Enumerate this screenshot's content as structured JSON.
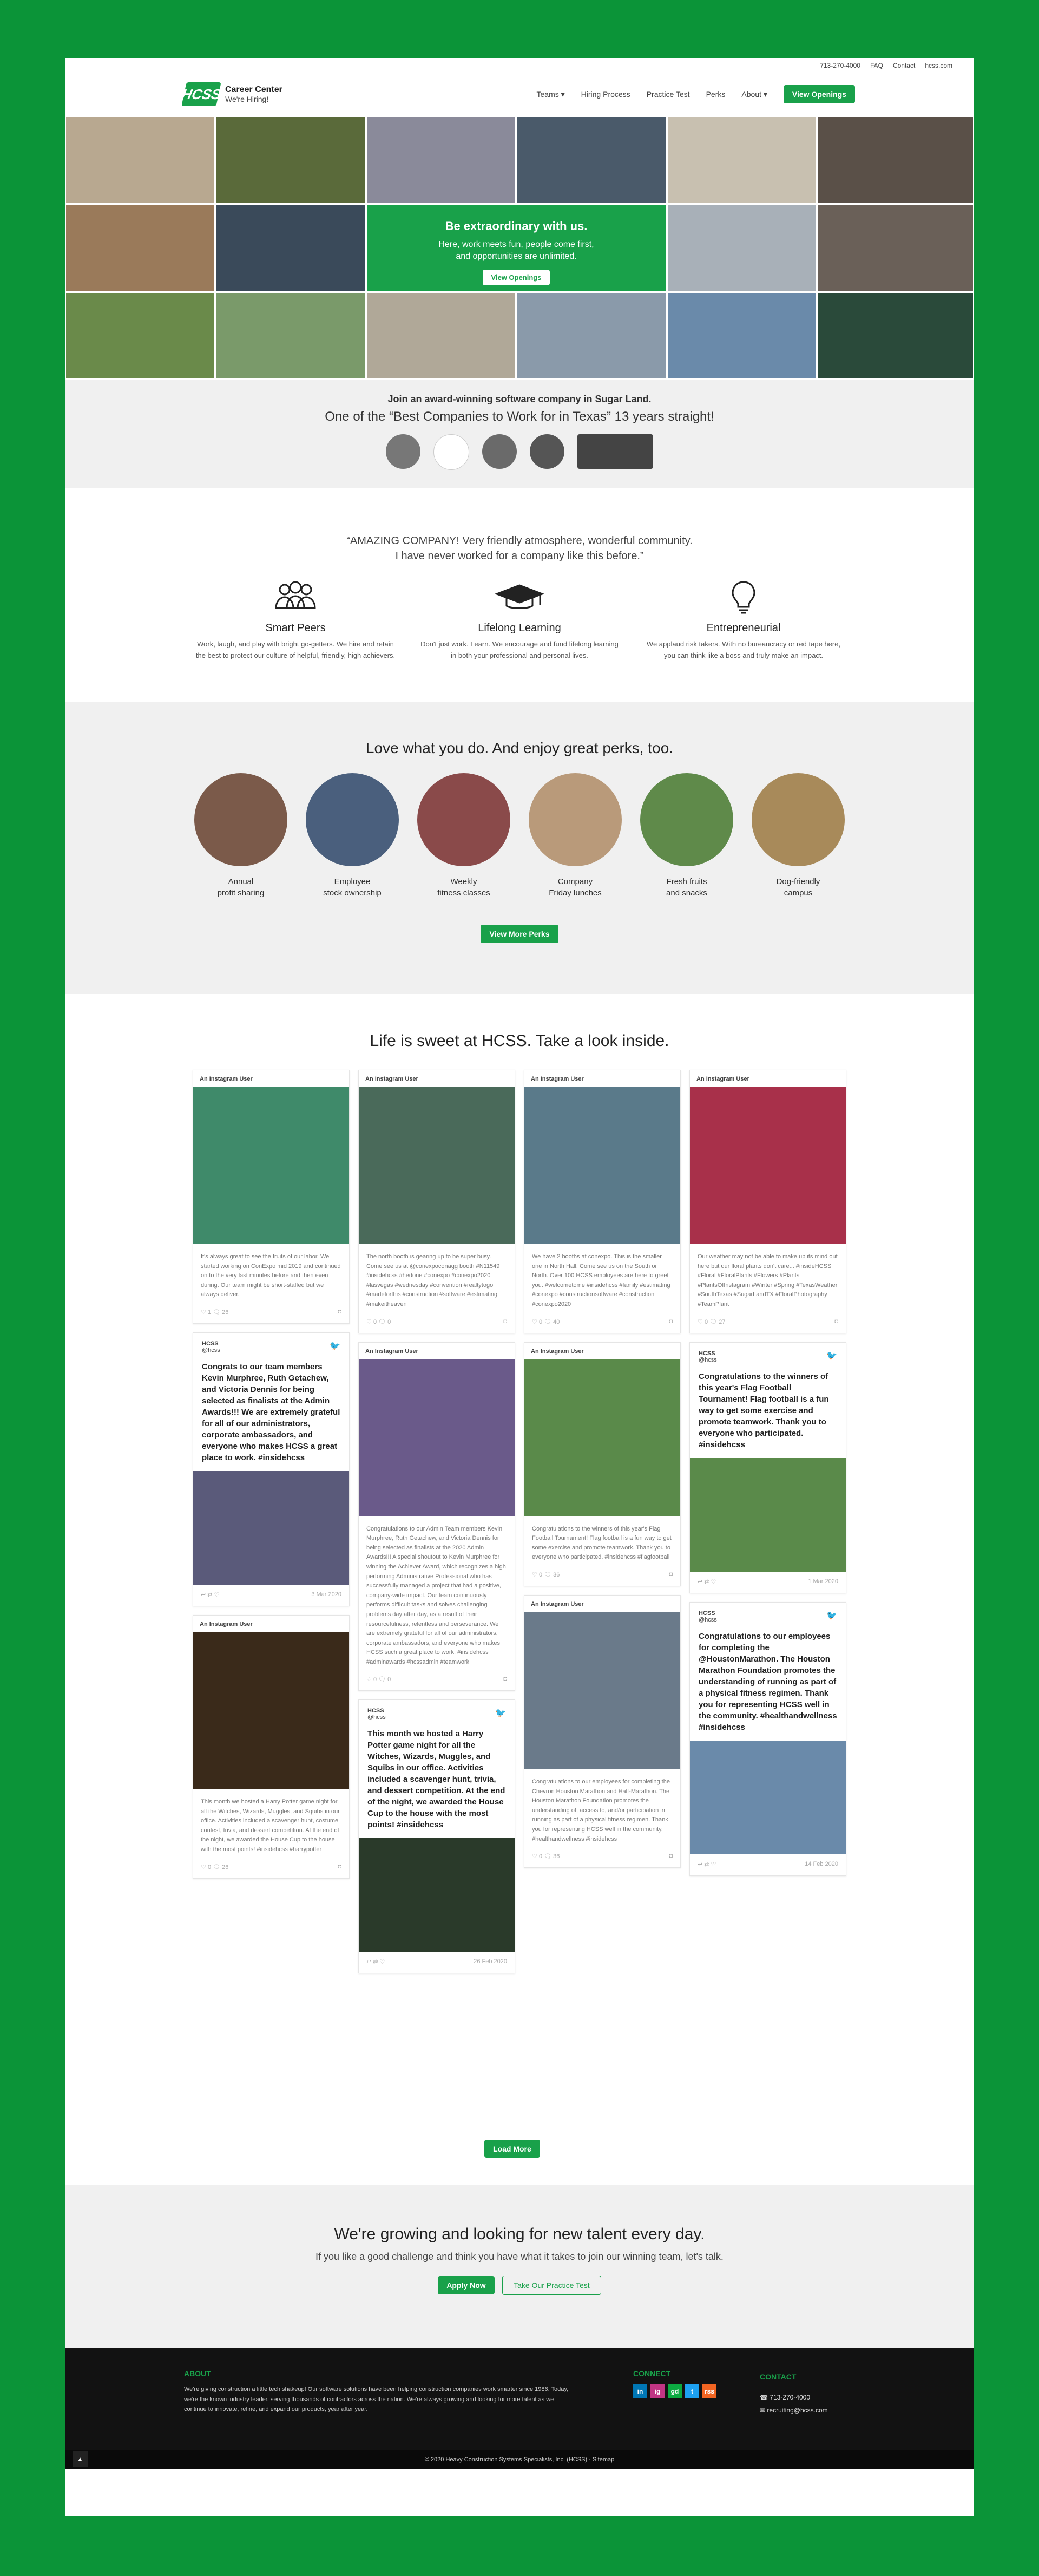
{
  "utility": {
    "phone": "713-270-4000",
    "links": [
      "FAQ",
      "Contact",
      "hcss.com"
    ]
  },
  "header": {
    "logo_mark": "HCSS",
    "title": "Career Center",
    "subtitle": "We're Hiring!",
    "nav": [
      "Teams",
      "Hiring Process",
      "Practice Test",
      "Perks",
      "About"
    ],
    "cta": "View Openings"
  },
  "hero": {
    "headline": "Be extraordinary with us.",
    "sub1": "Here, work meets fun, people come first,",
    "sub2": "and opportunities are unlimited.",
    "button": "View Openings"
  },
  "awards": {
    "line1": "Join an award-winning software company in Sugar Land.",
    "line2": "One of the “Best Companies to Work for in Texas” 13 years straight!",
    "badges": [
      "award-1",
      "award-2",
      "award-3",
      "award-4",
      "award-5"
    ]
  },
  "values": {
    "quote1": "“AMAZING COMPANY! Very friendly atmosphere, wonderful community.",
    "quote2": "I have never worked for a company like this before.”",
    "items": [
      {
        "icon": "people-icon",
        "title": "Smart Peers",
        "text": "Work, laugh, and play with bright go-getters. We hire and retain the best to protect our culture of helpful, friendly, high achievers."
      },
      {
        "icon": "graduation-cap-icon",
        "title": "Lifelong Learning",
        "text": "Don't just work. Learn. We encourage and fund lifelong learning in both your professional and personal lives."
      },
      {
        "icon": "lightbulb-icon",
        "title": "Entrepreneurial",
        "text": "We applaud risk takers. With no bureaucracy or red tape here, you can think like a boss and truly make an impact."
      }
    ]
  },
  "perks": {
    "title": "Love what you do. And enjoy great perks, too.",
    "items": [
      {
        "label": "Annual\nprofit sharing",
        "color": "#7b5a4a"
      },
      {
        "label": "Employee\nstock ownership",
        "color": "#4a5f7d"
      },
      {
        "label": "Weekly\nfitness classes",
        "color": "#8a4a4a"
      },
      {
        "label": "Company\nFriday lunches",
        "color": "#b99a7a"
      },
      {
        "label": "Fresh fruits\nand snacks",
        "color": "#5f8a4a"
      },
      {
        "label": "Dog-friendly\ncampus",
        "color": "#a88a5a"
      }
    ],
    "button": "View More Perks"
  },
  "social": {
    "title": "Life is sweet at HCSS. Take a look inside.",
    "load_more": "Load More",
    "ig_label": "An Instagram User",
    "tw_name": "HCSS",
    "tw_handle": "@hcss",
    "col1": [
      {
        "type": "ig",
        "img": "#3f8a6a",
        "text": "It's always great to see the fruits of our labor. We started working on ConExpo mid 2019 and continued on to the very last minutes before and then even during. Our team might be short-staffed but we always deliver.",
        "likes": "1",
        "comments": "26"
      },
      {
        "type": "tw",
        "text": "Congrats to our team members Kevin Murphree, Ruth Getachew, and Victoria Dennis for being selected as finalists at the Admin Awards!!! We are extremely grateful for all of our administrators, corporate ambassadors, and everyone who makes HCSS a great place to work. #insidehcss",
        "img": "#5a5a7a",
        "date": "3 Mar 2020"
      },
      {
        "type": "ig",
        "img": "#3a2a1a",
        "text": "This month we hosted a Harry Potter game night for all the Witches, Wizards, Muggles, and Squibs in our office. Activities included a scavenger hunt, costume contest, trivia, and dessert competition. At the end of the night, we awarded the House Cup to the house with the most points! #insidehcss #harrypotter",
        "likes": "0",
        "comments": "26"
      }
    ],
    "col2": [
      {
        "type": "ig",
        "img": "#4a6a5a",
        "text": "The north booth is gearing up to be super busy. Come see us at @conexpoconagg booth #N11549 #insidehcss #hedone #conexpo #conexpo2020 #lasvegas #wednesday #convention #realtytogo #madeforthis #construction #software #estimating #makeitheaven",
        "likes": "0",
        "comments": "0"
      },
      {
        "type": "ig",
        "img": "#6a5a8a",
        "text": "Congratulations to our Admin Team members Kevin Murphree, Ruth Getachew, and Victoria Dennis for being selected as finalists at the 2020 Admin Awards!!! A special shoutout to Kevin Murphree for winning the Achiever Award, which recognizes a high performing Administrative Professional who has successfully managed a project that had a positive, company-wide impact. Our team continuously performs difficult tasks and solves challenging problems day after day, as a result of their resourcefulness, relentless and perseverance. We are extremely grateful for all of our administrators, corporate ambassadors, and everyone who makes HCSS such a great place to work. #insidehcss #adminawards #hcssadmin #teamwork",
        "likes": "0",
        "comments": "0"
      },
      {
        "type": "tw",
        "text": "This month we hosted a Harry Potter game night for all the Witches, Wizards, Muggles, and Squibs in our office. Activities included a scavenger hunt, trivia, and dessert competition. At the end of the night, we awarded the House Cup to the house with the most points! #insidehcss",
        "img": "#2a3a2a",
        "date": "26 Feb 2020"
      }
    ],
    "col3": [
      {
        "type": "ig",
        "img": "#5a7a8a",
        "text": "We have 2 booths at conexpo. This is the smaller one in North Hall. Come see us on the South or North. Over 100 HCSS employees are here to greet you. #welcometome #insidehcss #family #estimating #conexpo #constructionsoftware #construction #conexpo2020",
        "likes": "0",
        "comments": "40"
      },
      {
        "type": "ig",
        "img": "#5a8a4a",
        "text": "Congratulations to the winners of this year's Flag Football Tournament! Flag football is a fun way to get some exercise and promote teamwork. Thank you to everyone who participated. #insidehcss #flagfootball",
        "likes": "0",
        "comments": "36"
      },
      {
        "type": "ig",
        "img": "#6a7a8a",
        "text": "Congratulations to our employees for completing the Chevron Houston Marathon and Half-Marathon. The Houston Marathon Foundation promotes the understanding of, access to, and/or participation in running as part of a physical fitness regimen. Thank you for representing HCSS well in the community. #healthandwellness #insidehcss",
        "likes": "0",
        "comments": "36"
      }
    ],
    "col4": [
      {
        "type": "ig",
        "img": "#a8304a",
        "text": "Our weather may not be able to make up its mind out here but our floral plants don't care... #insideHCSS #Floral #FloralPlants #Flowers #Plants #PlantsOfInstagram #Winter #Spring #TexasWeather #SouthTexas #SugarLandTX #FloralPhotography #TeamPlant",
        "likes": "0",
        "comments": "27"
      },
      {
        "type": "tw",
        "text": "Congratulations to the winners of this year's Flag Football Tournament! Flag football is a fun way to get some exercise and promote teamwork. Thank you to everyone who participated. #insidehcss",
        "img": "#5a8a4a",
        "date": "1 Mar 2020"
      },
      {
        "type": "tw",
        "text": "Congratulations to our employees for completing the @HoustonMarathon. The Houston Marathon Foundation promotes the understanding of running as part of a physical fitness regimen. Thank you for representing HCSS well in the community. #healthandwellness #insidehcss",
        "img": "#6a8aaa",
        "date": "14 Feb 2020"
      }
    ]
  },
  "join": {
    "title": "We're growing and looking for new talent every day.",
    "sub": "If you like a good challenge and think you have what it takes to join our winning team, let's talk.",
    "apply": "Apply Now",
    "practice": "Take Our Practice Test"
  },
  "footer": {
    "about_title": "ABOUT",
    "about_text": "We're giving construction a little tech shakeup! Our software solutions have been helping construction companies work smarter since 1986. Today, we're the known industry leader, serving thousands of contractors across the nation. We're always growing and looking for more talent as we continue to innovate, refine, and expand our products, year after year.",
    "connect_title": "CONNECT",
    "social": [
      {
        "label": "in",
        "color": "#0077b5"
      },
      {
        "label": "ig",
        "color": "#c13584"
      },
      {
        "label": "gd",
        "color": "#0caa41"
      },
      {
        "label": "t",
        "color": "#1da1f2"
      },
      {
        "label": "rss",
        "color": "#f26522"
      }
    ],
    "contact_title": "CONTACT",
    "phone": "713-270-4000",
    "email": "recruiting@hcss.com",
    "copyright": "© 2020 Heavy Construction Systems Specialists, Inc. (HCSS) · Sitemap"
  }
}
